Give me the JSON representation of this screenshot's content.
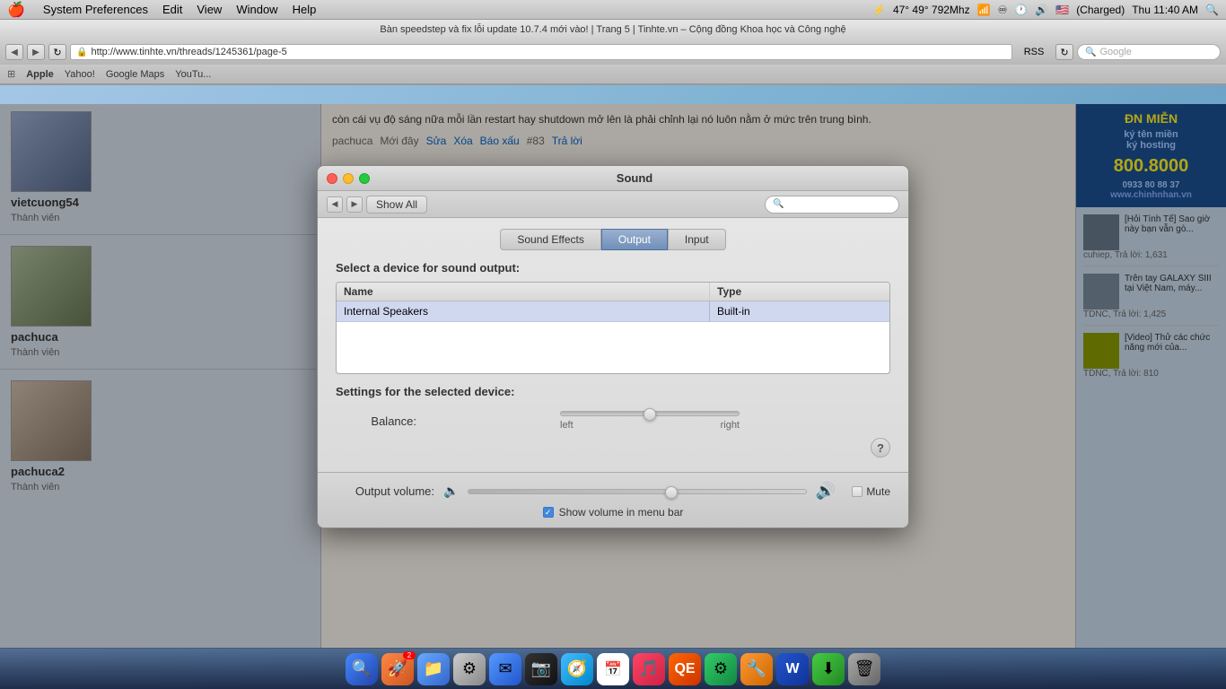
{
  "menubar": {
    "apple": "🍎",
    "items": [
      "System Preferences",
      "Edit",
      "View",
      "Window",
      "Help"
    ],
    "right_items": [
      "⚡",
      "47° 49° 792Mhz",
      "🔵",
      "⬛",
      "🎵",
      "♿",
      "🔊",
      "🇺🇸",
      "(Charged)",
      "Thu 11:40 AM",
      "🔍"
    ]
  },
  "browser": {
    "title": "Bàn speedstep và fix lỗi update 10.7.4 mới vào! | Trang 5 | Tinhte.vn – Cộng đồng Khoa học và Công nghệ",
    "url": "http://www.tinhte.vn/threads/1245361/page-5",
    "rss": "RSS",
    "search_placeholder": "Google",
    "bookmarks": [
      "Apple",
      "Yahoo!",
      "Google Maps",
      "YouTu..."
    ]
  },
  "sound_dialog": {
    "title": "Sound",
    "tabs": [
      "Sound Effects",
      "Output",
      "Input"
    ],
    "active_tab": "Output",
    "section_title": "Select a device for sound output:",
    "table": {
      "col_name": "Name",
      "col_type": "Type",
      "rows": [
        {
          "name": "Internal Speakers",
          "type": "Built-in"
        }
      ]
    },
    "settings_title": "Settings for the selected device:",
    "balance_label": "Balance:",
    "balance_left": "left",
    "balance_right": "right",
    "output_volume_label": "Output volume:",
    "mute_label": "Mute",
    "show_volume_label": "Show volume in menu bar",
    "show_volume_checked": true
  },
  "sidebar": {
    "users": [
      {
        "name": "vietcuong54",
        "role": "Thành viên"
      },
      {
        "name": "pachuca",
        "role": "Thành viên"
      },
      {
        "name": "pachuca2",
        "role": "Thành viên"
      }
    ]
  },
  "main_content": {
    "post_text": "còn cái vụ độ sáng nữa mỗi lần restart hay shutdown mở lên là phải chỉnh lại nó luôn nằm ở mức trên trung bình.",
    "author": "pachuca",
    "time": "Mới đây",
    "actions": [
      "Sửa",
      "Xóa",
      "Báo xấu"
    ],
    "post_number": "#83",
    "reply": "Trả lời"
  },
  "right_sidebar": {
    "ad_text": "ĐN MIỄN",
    "ad_domain": "800.8000",
    "ad_phone": "0933 80 88 37",
    "ad_website": "www.chinhnhan.vn",
    "news": [
      {
        "title": "[Hỏi Tình Tế] Sao giờ này bạn vẫn gò...",
        "author": "cuhiep,",
        "replies": "Trả lời: 1,631"
      },
      {
        "title": "Trên tay GALAXY SIII tại Việt Nam, máy...",
        "author": "TDNC,",
        "replies": "Trả lời: 1,425"
      },
      {
        "title": "[Video] Thử các chức năng mới của...",
        "author": "TDNC,",
        "replies": "Trả lời: 810"
      }
    ]
  },
  "dock": {
    "icons": [
      "🔍",
      "🚀",
      "📁",
      "⚙",
      "📧",
      "🔊",
      "📅",
      "🎵",
      "🎮",
      "QE",
      "⚙",
      "🔧",
      "📦",
      "🗑"
    ]
  },
  "icons": {
    "close": "✕",
    "minimize": "−",
    "maximize": "+",
    "back": "◀",
    "forward": "▶",
    "reload": "↻",
    "search": "🔍",
    "help": "?",
    "volume_low": "🔈",
    "volume_high": "🔊",
    "checkmark": "✓"
  }
}
